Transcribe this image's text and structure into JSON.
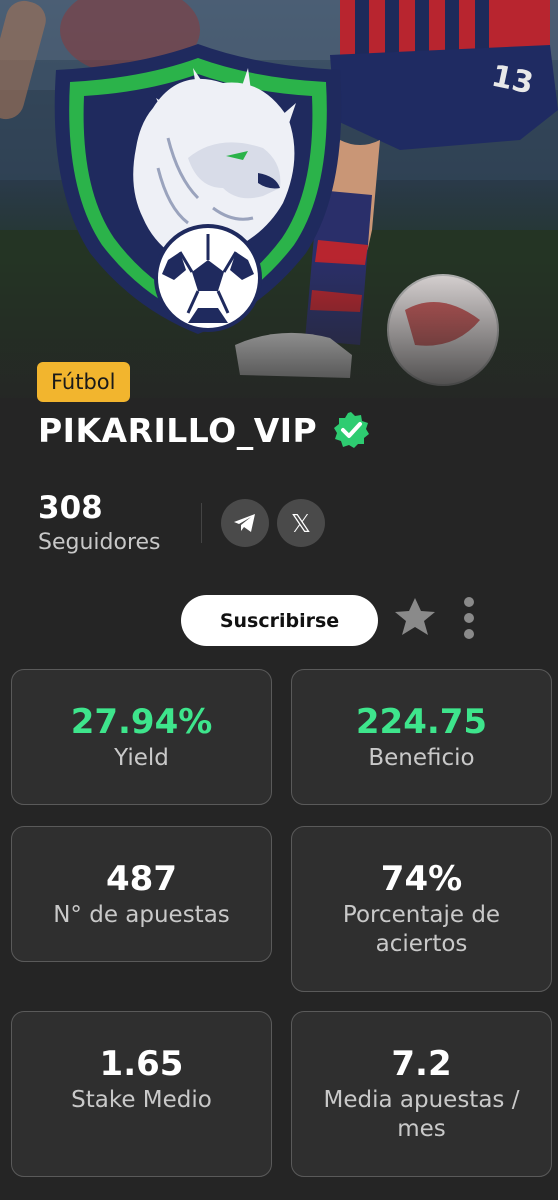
{
  "header": {
    "sport_badge": "Fútbol",
    "profile_name": "PIKARILLO_VIP",
    "verified": true
  },
  "followers": {
    "count": "308",
    "label": "Seguidores"
  },
  "social": [
    {
      "icon": "telegram-icon"
    },
    {
      "icon": "x-icon",
      "glyph": "𝕏"
    }
  ],
  "actions": {
    "subscribe_label": "Suscribirse",
    "favorite_icon": "star-icon",
    "more_icon": "more-vertical-icon"
  },
  "stats": [
    {
      "value": "27.94%",
      "label": "Yield",
      "highlight": true
    },
    {
      "value": "224.75",
      "label": "Beneficio",
      "highlight": true
    },
    {
      "value": "487",
      "label": "N° de apuestas",
      "highlight": false
    },
    {
      "value": "74%",
      "label": "Porcentaje de aciertos",
      "highlight": false
    },
    {
      "value": "1.65",
      "label": "Stake Medio",
      "highlight": false
    },
    {
      "value": "7.2",
      "label": "Media apuestas / mes",
      "highlight": false
    }
  ],
  "colors": {
    "accent_green": "#3ee58c",
    "badge_yellow": "#f2b52e",
    "verified_green": "#2ecc71",
    "background": "#252525",
    "card_border": "#5a5a5a"
  }
}
